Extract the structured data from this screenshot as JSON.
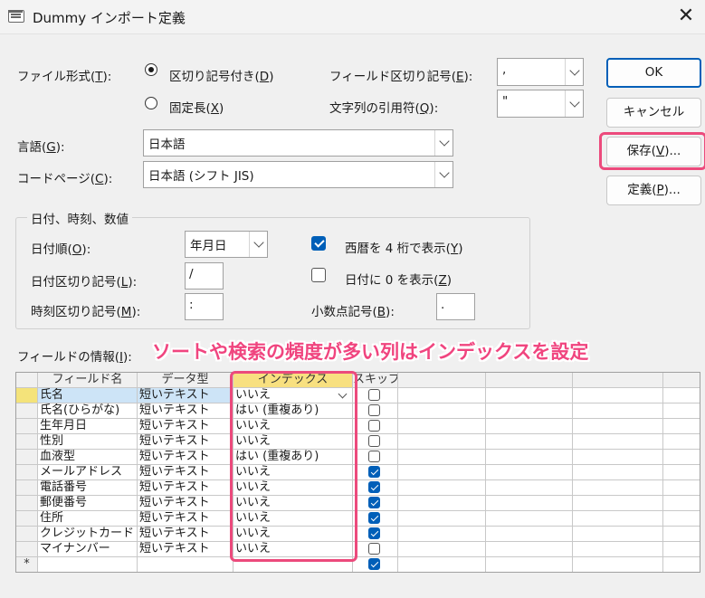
{
  "window": {
    "title": "Dummy インポート定義",
    "close_glyph": "✕"
  },
  "format": {
    "label_pre": "ファイル形式(",
    "label_key": "T",
    "label_post": "):",
    "delimited": {
      "pre": "区切り記号付き(",
      "key": "D",
      "post": ")",
      "selected": true
    },
    "fixed": {
      "pre": "固定長(",
      "key": "X",
      "post": ")",
      "selected": false
    }
  },
  "field_delim": {
    "pre": "フィールド区切り記号(",
    "key": "E",
    "post": "):",
    "value": ","
  },
  "text_qualifier": {
    "pre": "文字列の引用符(",
    "key": "Q",
    "post": "):",
    "value": "\""
  },
  "language": {
    "pre": "言語(",
    "key": "G",
    "post": "):",
    "value": "日本語"
  },
  "codepage": {
    "pre": "コードページ(",
    "key": "C",
    "post": "):",
    "value": "日本語 (シフト JIS)"
  },
  "buttons": {
    "ok": "OK",
    "cancel": "キャンセル",
    "save": {
      "pre": "保存(",
      "key": "V",
      "post": ")..."
    },
    "spec": {
      "pre": "定義(",
      "key": "P",
      "post": ")..."
    }
  },
  "dates": {
    "group_title": "日付、時刻、数値",
    "order": {
      "pre": "日付順(",
      "key": "O",
      "post": "):",
      "value": "年月日"
    },
    "date_delim": {
      "pre": "日付区切り記号(",
      "key": "L",
      "post": "):",
      "value": "/"
    },
    "time_delim": {
      "pre": "時刻区切り記号(",
      "key": "M",
      "post": "):",
      "value": ":"
    },
    "four_digit": {
      "pre": "西暦を 4 桁で表示(",
      "key": "Y",
      "post": ")",
      "checked": true
    },
    "leading_zero": {
      "pre": "日付に 0 を表示(",
      "key": "Z",
      "post": ")",
      "checked": false
    },
    "decimal": {
      "pre": "小数点記号(",
      "key": "B",
      "post": "):",
      "value": "."
    }
  },
  "field_info": {
    "pre": "フィールドの情報(",
    "key": "I",
    "post": "):"
  },
  "annotation": "ソートや検索の頻度が多い列はインデックスを設定",
  "grid": {
    "headers": {
      "name": "フィールド名",
      "type": "データ型",
      "index": "インデックス",
      "skip": "スキップ"
    },
    "new_row_marker": "*",
    "rows": [
      {
        "name": "氏名",
        "type": "短いテキスト",
        "index": "いいえ",
        "skip": false
      },
      {
        "name": "氏名(ひらがな)",
        "type": "短いテキスト",
        "index": "はい (重複あり)",
        "skip": false
      },
      {
        "name": "生年月日",
        "type": "短いテキスト",
        "index": "いいえ",
        "skip": false
      },
      {
        "name": "性別",
        "type": "短いテキスト",
        "index": "いいえ",
        "skip": false
      },
      {
        "name": "血液型",
        "type": "短いテキスト",
        "index": "はい (重複あり)",
        "skip": false
      },
      {
        "name": "メールアドレス",
        "type": "短いテキスト",
        "index": "いいえ",
        "skip": true
      },
      {
        "name": "電話番号",
        "type": "短いテキスト",
        "index": "いいえ",
        "skip": true
      },
      {
        "name": "郵便番号",
        "type": "短いテキスト",
        "index": "いいえ",
        "skip": true
      },
      {
        "name": "住所",
        "type": "短いテキスト",
        "index": "いいえ",
        "skip": true
      },
      {
        "name": "クレジットカード",
        "type": "短いテキスト",
        "index": "いいえ",
        "skip": true
      },
      {
        "name": "マイナンバー",
        "type": "短いテキスト",
        "index": "いいえ",
        "skip": false
      }
    ]
  },
  "colors": {
    "accent": "#005fb8",
    "highlight": "#ec4a7c"
  },
  "icons": {
    "window": "table-icon",
    "close": "close-icon",
    "dropdown": "chevron-down-icon"
  }
}
